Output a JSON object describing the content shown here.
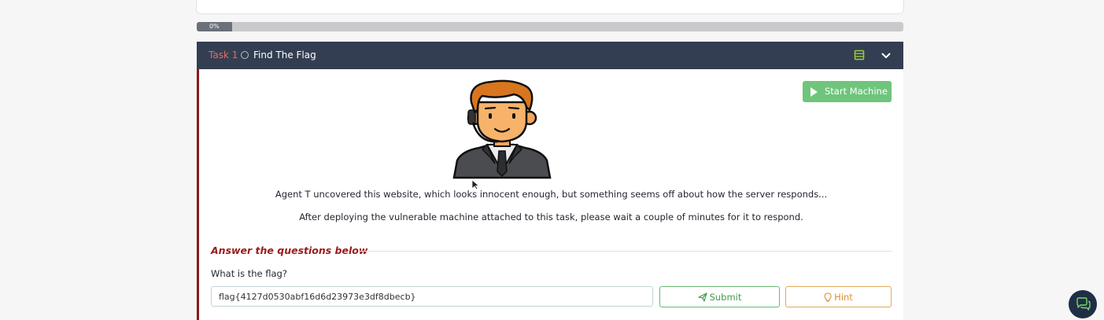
{
  "progress": {
    "label": "0%",
    "fraction": 0
  },
  "task": {
    "number": "Task 1",
    "title": "Find The Flag",
    "header_icons": [
      "list-icon",
      "chevron-down-icon"
    ],
    "start_machine_label": "Start Machine",
    "description_1": "Agent T uncovered this website, which looks innocent enough, but something seems off about how the server responds...",
    "description_2": "After deploying the vulnerable machine attached to this task, please wait a couple of minutes for it to respond.",
    "answers_heading": "Answer the questions below",
    "question": "What is the flag?",
    "answer_value": "flag{4127d0530abf16d6d23973e3df8dbecb}",
    "submit_label": "Submit",
    "hint_label": "Hint"
  },
  "colors": {
    "header_bg": "#343e52",
    "task_number": "#e56e58",
    "accent_red": "#9b1b1b",
    "start_green": "#6fc57b",
    "submit_green": "#3e9c4c",
    "hint_orange": "#e09134"
  }
}
